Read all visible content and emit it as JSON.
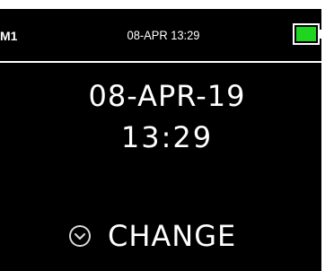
{
  "status_bar": {
    "profile": "M1",
    "datetime": "08-APR 13:29",
    "battery_color": "#1fd51f",
    "battery_icon": "battery-full-icon"
  },
  "main": {
    "date": "08-APR-19",
    "time": "13:29"
  },
  "action": {
    "icon": "down-circle-icon",
    "label": "CHANGE"
  }
}
